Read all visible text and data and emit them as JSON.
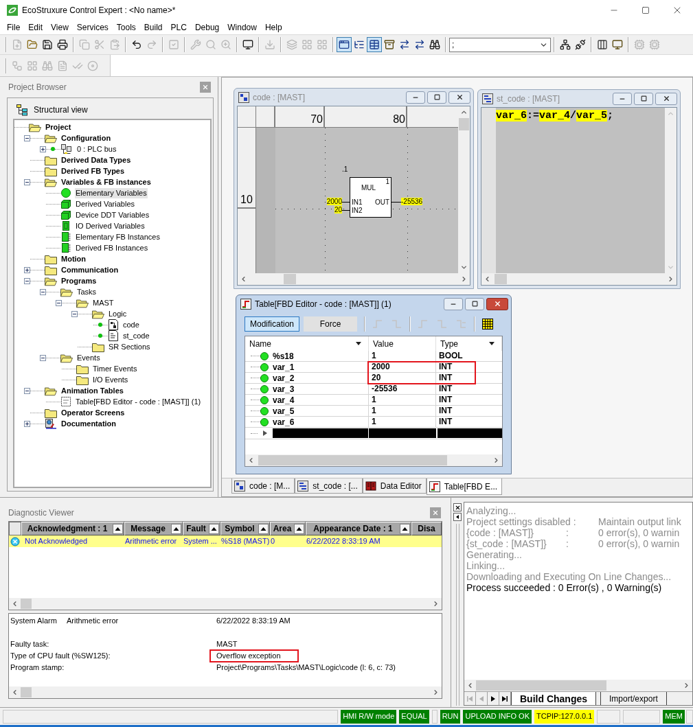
{
  "window": {
    "title": "EcoStruxure Control Expert : <No name>*"
  },
  "menu": [
    "File",
    "Edit",
    "View",
    "Services",
    "Tools",
    "Build",
    "PLC",
    "Debug",
    "Window",
    "Help"
  ],
  "toolbar_main": {
    "groups_left": [
      [
        {
          "kind": "new",
          "disabled": true,
          "pressed": false
        },
        {
          "kind": "open",
          "disabled": false,
          "pressed": false
        },
        {
          "kind": "save",
          "disabled": false,
          "pressed": false
        },
        {
          "kind": "print",
          "disabled": false,
          "pressed": false
        }
      ],
      [
        {
          "kind": "copy",
          "disabled": true,
          "pressed": false
        },
        {
          "kind": "cut",
          "disabled": true,
          "pressed": false
        },
        {
          "kind": "paste",
          "disabled": true,
          "pressed": false
        }
      ],
      [
        {
          "kind": "undo",
          "disabled": false,
          "pressed": false
        },
        {
          "kind": "redo",
          "disabled": true,
          "pressed": false
        }
      ],
      [
        {
          "kind": "validate",
          "disabled": true,
          "pressed": false
        }
      ],
      [
        {
          "kind": "analyze",
          "disabled": true,
          "pressed": false
        },
        {
          "kind": "search",
          "disabled": true,
          "pressed": false
        },
        {
          "kind": "zoom",
          "disabled": true,
          "pressed": false
        }
      ],
      [
        {
          "kind": "screen",
          "disabled": false,
          "pressed": false
        }
      ],
      [
        {
          "kind": "import",
          "disabled": true,
          "pressed": false
        }
      ],
      [
        {
          "kind": "layers",
          "disabled": true,
          "pressed": false
        },
        {
          "kind": "grid",
          "disabled": true,
          "pressed": false
        },
        {
          "kind": "grid",
          "disabled": true,
          "pressed": false
        }
      ],
      [
        {
          "kind": "window",
          "disabled": false,
          "pressed": true
        },
        {
          "kind": "tree",
          "disabled": false,
          "pressed": false
        },
        {
          "kind": "table",
          "disabled": false,
          "pressed": true
        },
        {
          "kind": "archive",
          "disabled": false,
          "pressed": false
        },
        {
          "kind": "arrows",
          "disabled": false,
          "pressed": false
        },
        {
          "kind": "arrows",
          "disabled": false,
          "pressed": false
        },
        {
          "kind": "binoculars",
          "disabled": false,
          "pressed": false
        }
      ]
    ],
    "combo": {
      "value": ";"
    },
    "groups_right": [
      [
        {
          "kind": "connect",
          "disabled": false,
          "pressed": false
        },
        {
          "kind": "disconnect",
          "disabled": false,
          "pressed": false
        }
      ],
      [
        {
          "kind": "rack",
          "disabled": false,
          "pressed": false
        },
        {
          "kind": "monitor",
          "disabled": false,
          "pressed": false
        }
      ],
      [
        {
          "kind": "cpu",
          "disabled": true,
          "pressed": false
        },
        {
          "kind": "cpu",
          "disabled": true,
          "pressed": false
        }
      ]
    ]
  },
  "toolbar_secondary": {
    "groups": [
      [
        {
          "kind": "flow",
          "disabled": true,
          "pressed": false
        },
        {
          "kind": "grid",
          "disabled": true,
          "pressed": false
        },
        {
          "kind": "binoculars",
          "disabled": true,
          "pressed": false
        },
        {
          "kind": "doc",
          "disabled": true,
          "pressed": false
        },
        {
          "kind": "ack",
          "disabled": true,
          "pressed": false
        },
        {
          "kind": "disc",
          "disabled": true,
          "pressed": false
        }
      ]
    ]
  },
  "project_browser": {
    "title": "Project Browser",
    "view": "Structural view",
    "tree": [
      {
        "label": "Project",
        "kind": "folder-open",
        "selected": false,
        "children": [
          {
            "label": "Configuration",
            "kind": "folder-open",
            "expanded": true,
            "selected": false,
            "children": [
              {
                "label": "0 : PLC bus",
                "kind": "bus",
                "expanded": false,
                "selected": false
              }
            ]
          },
          {
            "label": "Derived Data Types",
            "kind": "folder",
            "selected": false
          },
          {
            "label": "Derived FB Types",
            "kind": "folder",
            "selected": false
          },
          {
            "label": "Variables & FB instances",
            "kind": "folder-open",
            "expanded": true,
            "selected": false,
            "children": [
              {
                "label": "Elementary Variables",
                "kind": "elementary-variables",
                "selected": true
              },
              {
                "label": "Derived Variables",
                "kind": "derived-variables",
                "selected": false
              },
              {
                "label": "Device DDT Variables",
                "kind": "derived-variables",
                "selected": false
              },
              {
                "label": "IO Derived Variables",
                "kind": "io-variables",
                "selected": false
              },
              {
                "label": "Elementary FB Instances",
                "kind": "fb-instances",
                "selected": false
              },
              {
                "label": "Derived FB Instances",
                "kind": "fb-instances",
                "selected": false
              }
            ]
          },
          {
            "label": "Motion",
            "kind": "folder",
            "selected": false
          },
          {
            "label": "Communication",
            "kind": "folder",
            "expanded": false,
            "selected": false
          },
          {
            "label": "Programs",
            "kind": "folder-open",
            "expanded": true,
            "selected": false,
            "children": [
              {
                "label": "Tasks",
                "kind": "folder-open",
                "expanded": true,
                "selected": false,
                "children": [
                  {
                    "label": "MAST",
                    "kind": "folder-open",
                    "expanded": true,
                    "selected": false,
                    "children": [
                      {
                        "label": "Logic",
                        "kind": "folder-open",
                        "expanded": true,
                        "selected": false,
                        "children": [
                          {
                            "label": "code",
                            "kind": "fbd-section",
                            "selected": false
                          },
                          {
                            "label": "st_code",
                            "kind": "st-section",
                            "selected": false
                          }
                        ]
                      },
                      {
                        "label": "SR Sections",
                        "kind": "folder",
                        "selected": false
                      }
                    ]
                  }
                ]
              },
              {
                "label": "Events",
                "kind": "folder-open",
                "expanded": true,
                "selected": false,
                "children": [
                  {
                    "label": "Timer Events",
                    "kind": "folder",
                    "selected": false
                  },
                  {
                    "label": "I/O Events",
                    "kind": "folder",
                    "selected": false
                  }
                ]
              }
            ]
          },
          {
            "label": "Animation Tables",
            "kind": "folder-open",
            "expanded": true,
            "selected": false,
            "children": [
              {
                "label": "Table[FBD Editor - code : [MAST]] (1)",
                "kind": "animation-table",
                "selected": false
              }
            ]
          },
          {
            "label": "Operator Screens",
            "kind": "folder",
            "selected": false
          },
          {
            "label": "Documentation",
            "kind": "documentation",
            "expanded": false,
            "selected": false
          }
        ]
      }
    ]
  },
  "editors": [
    {
      "kind": "fbd",
      "title": "code : [MAST]",
      "active": false,
      "ruler": {
        "columns": [
          "70",
          "80"
        ],
        "rows": [
          "10"
        ]
      },
      "block": {
        "instance": ".1",
        "number": "1",
        "name": "MUL",
        "inputs": [
          {
            "pin": "IN1",
            "value": "2000"
          },
          {
            "pin": "IN2",
            "value": "20"
          }
        ],
        "outputs": [
          {
            "pin": "OUT",
            "value": "-25536"
          }
        ]
      }
    },
    {
      "kind": "st",
      "title": "st_code : [MAST]",
      "active": false,
      "code": [
        {
          "text": "var_6",
          "highlight": true
        },
        {
          "text": ":=",
          "highlight": false
        },
        {
          "text": "var_4",
          "highlight": true
        },
        {
          "text": "/",
          "highlight": false
        },
        {
          "text": "var_5",
          "highlight": true
        },
        {
          "text": ";",
          "highlight": false
        }
      ]
    },
    {
      "kind": "animation-table",
      "title": "Table[FBD Editor - code : [MAST]] (1)",
      "active": true,
      "modes": [
        {
          "label": "Modification",
          "selected": true
        },
        {
          "label": "Force",
          "selected": false
        }
      ],
      "columns": [
        "Name",
        "Value",
        "Type"
      ],
      "rows": [
        {
          "name": "%s18",
          "value": "1",
          "type": "BOOL",
          "marked": false
        },
        {
          "name": "var_1",
          "value": "2000",
          "type": "INT",
          "marked": true
        },
        {
          "name": "var_2",
          "value": "20",
          "type": "INT",
          "marked": true
        },
        {
          "name": "var_3",
          "value": "-25536",
          "type": "INT",
          "marked": false
        },
        {
          "name": "var_4",
          "value": "1",
          "type": "INT",
          "marked": false
        },
        {
          "name": "var_5",
          "value": "1",
          "type": "INT",
          "marked": false
        },
        {
          "name": "var_6",
          "value": "1",
          "type": "INT",
          "marked": false
        }
      ]
    }
  ],
  "document_tabs": [
    {
      "label": "code : [M...",
      "kind": "fbd",
      "selected": false
    },
    {
      "label": "st_code : [...",
      "kind": "st",
      "selected": false
    },
    {
      "label": "Data Editor",
      "kind": "data-editor",
      "selected": false
    },
    {
      "label": "Table[FBD E...",
      "kind": "animation-table",
      "selected": true
    }
  ],
  "diagnostic_viewer": {
    "title": "Diagnostic Viewer",
    "columns": [
      "Acknowledgment : 1",
      "Message",
      "Fault",
      "Symbol",
      "Area",
      "Appearance Date : 1",
      "Disa"
    ],
    "rows": [
      {
        "cells": [
          "Not Acknowledged",
          "Arithmetic error",
          "System ...",
          "%S18 (MAST)",
          "0",
          "6/22/2022 8:33:19 AM"
        ],
        "selected": true
      }
    ],
    "summary": {
      "type": "System Alarm",
      "message": "Arithmetic error",
      "date": "6/22/2022 8:33:19 AM"
    },
    "details": [
      {
        "label": "Faulty task:",
        "value": "MAST",
        "marked": false
      },
      {
        "label": "Type of CPU fault (%SW125):",
        "value": "Overflow exception",
        "marked": true
      },
      {
        "label": "Program stamp:",
        "value": "Project\\Programs\\Tasks\\MAST\\Logic\\code (l: 6, c: 73)",
        "marked": false
      }
    ]
  },
  "output": {
    "lines": [
      {
        "kind": "info",
        "text": "Analyzing..."
      },
      {
        "kind": "info",
        "label": "Project settings disabled :",
        "value": "Maintain output link"
      },
      {
        "kind": "info",
        "label": "{code : [MAST]}",
        "separator": ":",
        "value": "0 error(s), 0 warnin"
      },
      {
        "kind": "info",
        "label": "{st_code : [MAST]}",
        "separator": ":",
        "value": "0 error(s), 0 warnin"
      },
      {
        "kind": "info",
        "text": "Generating..."
      },
      {
        "kind": "info",
        "text": "Linking..."
      },
      {
        "kind": "info",
        "text": "Downloading and Executing On Line Changes..."
      },
      {
        "kind": "result",
        "text": "Process succeeded : 0 Error(s) , 0 Warning(s)"
      }
    ],
    "tabs": [
      {
        "label": "Build Changes",
        "selected": true
      },
      {
        "label": "Import/export",
        "selected": false
      }
    ]
  },
  "status_bar": [
    {
      "label": "HMI R/W mode",
      "color": "#008000"
    },
    {
      "label": "EQUAL",
      "color": "#008000"
    },
    {
      "label": "RUN",
      "color": "#008000"
    },
    {
      "label": "UPLOAD INFO OK",
      "color": "#008000"
    },
    {
      "label": "TCPIP:127.0.0.1",
      "color": "#ffff00"
    },
    {
      "label": "MEM",
      "color": "#008000"
    }
  ]
}
